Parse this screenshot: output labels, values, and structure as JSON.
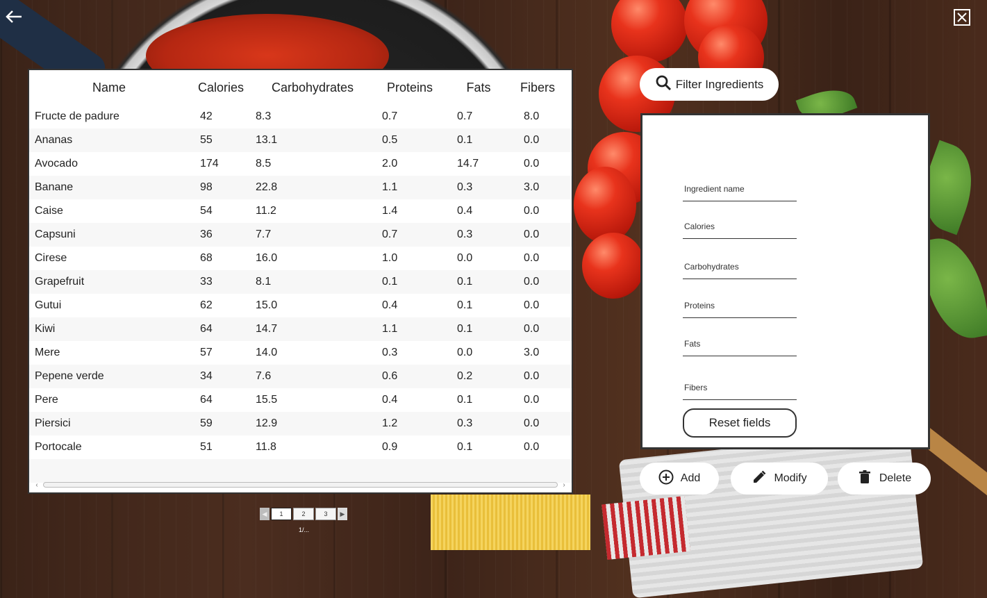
{
  "table": {
    "headers": [
      "Name",
      "Calories",
      "Carbohydrates",
      "Proteins",
      "Fats",
      "Fibers"
    ],
    "rows": [
      [
        "Fructe de padure",
        "42",
        "8.3",
        "0.7",
        "0.7",
        "8.0"
      ],
      [
        "Ananas",
        "55",
        "13.1",
        "0.5",
        "0.1",
        "0.0"
      ],
      [
        "Avocado",
        "174",
        "8.5",
        "2.0",
        "14.7",
        "0.0"
      ],
      [
        "Banane",
        "98",
        "22.8",
        "1.1",
        "0.3",
        "3.0"
      ],
      [
        "Caise",
        "54",
        "11.2",
        "1.4",
        "0.4",
        "0.0"
      ],
      [
        "Capsuni",
        "36",
        "7.7",
        "0.7",
        "0.3",
        "0.0"
      ],
      [
        "Cirese",
        "68",
        "16.0",
        "1.0",
        "0.0",
        "0.0"
      ],
      [
        "Grapefruit",
        "33",
        "8.1",
        "0.1",
        "0.1",
        "0.0"
      ],
      [
        "Gutui",
        "62",
        "15.0",
        "0.4",
        "0.1",
        "0.0"
      ],
      [
        "Kiwi",
        "64",
        "14.7",
        "1.1",
        "0.1",
        "0.0"
      ],
      [
        "Mere",
        "57",
        "14.0",
        "0.3",
        "0.0",
        "3.0"
      ],
      [
        "Pepene verde",
        "34",
        "7.6",
        "0.6",
        "0.2",
        "0.0"
      ],
      [
        "Pere",
        "64",
        "15.5",
        "0.4",
        "0.1",
        "0.0"
      ],
      [
        "Piersici",
        "59",
        "12.9",
        "1.2",
        "0.3",
        "0.0"
      ],
      [
        "Portocale",
        "51",
        "11.8",
        "0.9",
        "0.1",
        "0.0"
      ]
    ]
  },
  "pagination": {
    "pages": [
      "1",
      "2",
      "3"
    ],
    "active_page": "1",
    "info": "1/..."
  },
  "filter": {
    "label": "Filter Ingredients",
    "icon": "search-icon"
  },
  "form": {
    "ingredient_name_label": "Ingredient name",
    "calories_label": "Calories",
    "carbohydrates_label": "Carbohydrates",
    "proteins_label": "Proteins",
    "fats_label": "Fats",
    "fibers_label": "Fibers",
    "reset_label": "Reset fields"
  },
  "actions": {
    "add_label": "Add",
    "modify_label": "Modify",
    "delete_label": "Delete"
  },
  "icons": {
    "back": "back-arrow-icon",
    "close": "close-icon"
  }
}
